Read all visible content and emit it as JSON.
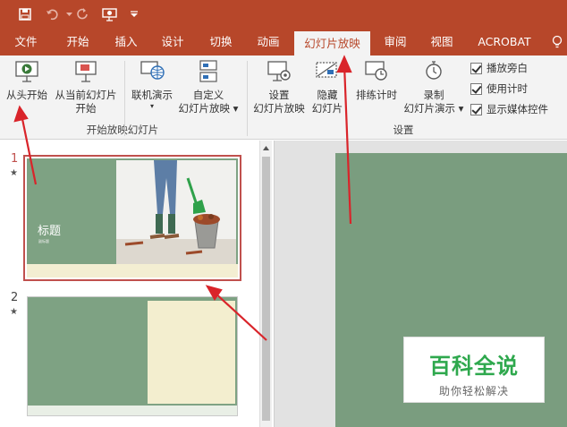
{
  "quick_access": {
    "save": "save-icon",
    "undo": "undo-icon",
    "redo": "redo-icon",
    "present": "present-from-start-icon",
    "customize": "customize-qat-icon"
  },
  "tabs": [
    {
      "label": "文件"
    },
    {
      "label": "开始"
    },
    {
      "label": "插入"
    },
    {
      "label": "设计"
    },
    {
      "label": "切换"
    },
    {
      "label": "动画"
    },
    {
      "label": "幻灯片放映",
      "active": true
    },
    {
      "label": "审阅"
    },
    {
      "label": "视图"
    },
    {
      "label": "ACROBAT"
    }
  ],
  "ribbon": {
    "groups": {
      "start_show": "开始放映幻灯片",
      "setup": "设置"
    },
    "buttons": {
      "from_beginning": "从头开始",
      "from_current_line1": "从当前幻灯片",
      "from_current_line2": "开始",
      "online_line1": "联机演示",
      "custom_line1": "自定义",
      "custom_line2": "幻灯片放映",
      "setup_line1": "设置",
      "setup_line2": "幻灯片放映",
      "hide_line1": "隐藏",
      "hide_line2": "幻灯片",
      "rehearse": "排练计时",
      "record_line1": "录制",
      "record_line2": "幻灯片演示"
    },
    "checkboxes": [
      {
        "label": "播放旁白",
        "checked": true
      },
      {
        "label": "使用计时",
        "checked": true
      },
      {
        "label": "显示媒体控件",
        "checked": true
      }
    ]
  },
  "slides": [
    {
      "number": "1",
      "star": "★",
      "title": "标题",
      "subtitle": "副标题",
      "selected": true
    },
    {
      "number": "2",
      "star": "★",
      "selected": false
    }
  ],
  "watermark": {
    "main": "百科全说",
    "sub": "助你轻松解决"
  },
  "colors": {
    "accent": "#b7472a",
    "slide_green": "#7a9d7f",
    "arrow": "#d9242a"
  }
}
